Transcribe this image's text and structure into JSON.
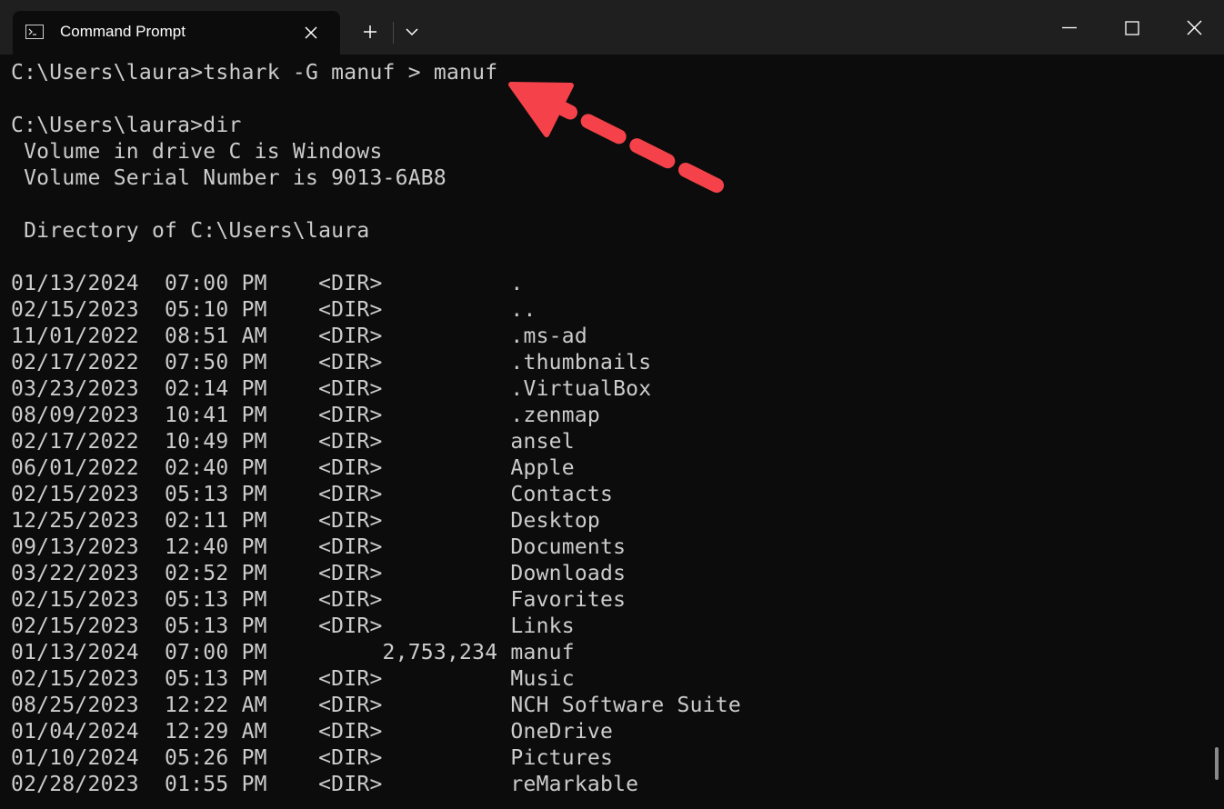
{
  "window": {
    "tab_title": "Command Prompt",
    "tab_icon": "console-icon",
    "buttons": [
      "close-tab-icon",
      "new-tab-icon",
      "tab-dropdown-icon",
      "minimize-icon",
      "maximize-icon",
      "close-window-icon"
    ]
  },
  "terminal": {
    "lines": [
      "C:\\Users\\laura>tshark -G manuf > manuf",
      "",
      "C:\\Users\\laura>dir",
      " Volume in drive C is Windows",
      " Volume Serial Number is 9013-6AB8",
      "",
      " Directory of C:\\Users\\laura",
      "",
      "01/13/2024  07:00 PM    <DIR>          .",
      "02/15/2023  05:10 PM    <DIR>          ..",
      "11/01/2022  08:51 AM    <DIR>          .ms-ad",
      "02/17/2022  07:50 PM    <DIR>          .thumbnails",
      "03/23/2023  02:14 PM    <DIR>          .VirtualBox",
      "08/09/2023  10:41 PM    <DIR>          .zenmap",
      "02/17/2022  10:49 PM    <DIR>          ansel",
      "06/01/2022  02:40 PM    <DIR>          Apple",
      "02/15/2023  05:13 PM    <DIR>          Contacts",
      "12/25/2023  02:11 PM    <DIR>          Desktop",
      "09/13/2023  12:40 PM    <DIR>          Documents",
      "03/22/2023  02:52 PM    <DIR>          Downloads",
      "02/15/2023  05:13 PM    <DIR>          Favorites",
      "02/15/2023  05:13 PM    <DIR>          Links",
      "01/13/2024  07:00 PM         2,753,234 manuf",
      "02/15/2023  05:13 PM    <DIR>          Music",
      "08/25/2023  12:22 AM    <DIR>          NCH Software Suite",
      "01/04/2024  12:29 AM    <DIR>          OneDrive",
      "01/10/2024  05:26 PM    <DIR>          Pictures",
      "02/28/2023  01:55 PM    <DIR>          reMarkable"
    ]
  },
  "annotation": {
    "arrow_color": "#f5424a"
  }
}
